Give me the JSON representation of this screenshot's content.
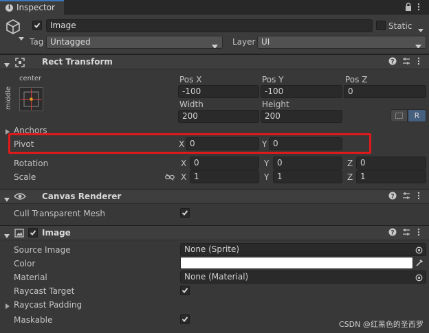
{
  "tab": {
    "title": "Inspector"
  },
  "object": {
    "name": "Image",
    "static_label": "Static",
    "tag_label": "Tag",
    "tag_value": "Untagged",
    "layer_label": "Layer",
    "layer_value": "UI"
  },
  "rect_transform": {
    "title": "Rect Transform",
    "anchor_h": "center",
    "anchor_v": "middle",
    "pos_x_label": "Pos X",
    "pos_x": "-100",
    "pos_y_label": "Pos Y",
    "pos_y": "-100",
    "pos_z_label": "Pos Z",
    "pos_z": "0",
    "width_label": "Width",
    "width": "200",
    "height_label": "Height",
    "height": "200",
    "r_button": "R",
    "anchors_label": "Anchors",
    "pivot_label": "Pivot",
    "pivot_x_label": "X",
    "pivot_x": "0",
    "pivot_y_label": "Y",
    "pivot_y": "0",
    "rotation_label": "Rotation",
    "rot_x": "0",
    "rot_y": "0",
    "rot_z": "0",
    "scale_label": "Scale",
    "scale_x": "1",
    "scale_y": "1",
    "scale_z": "1",
    "axis_x": "X",
    "axis_y": "Y",
    "axis_z": "Z"
  },
  "canvas_renderer": {
    "title": "Canvas Renderer",
    "cull_label": "Cull Transparent Mesh"
  },
  "image": {
    "title": "Image",
    "source_label": "Source Image",
    "source_value": "None (Sprite)",
    "color_label": "Color",
    "color_value": "#ffffff",
    "material_label": "Material",
    "material_value": "None (Material)",
    "raycast_target_label": "Raycast Target",
    "raycast_padding_label": "Raycast Padding",
    "maskable_label": "Maskable"
  },
  "watermark": "CSDN @红黑色的圣西罗",
  "colors": {
    "highlight": "#e0191a",
    "panel": "#383838",
    "header": "#3e3e3e",
    "field": "#2a2a2a"
  }
}
